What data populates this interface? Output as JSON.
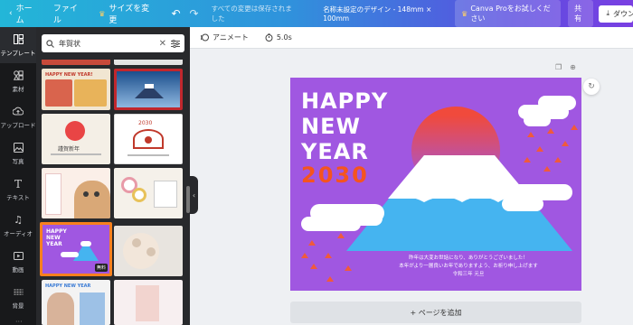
{
  "topbar": {
    "home": "ホーム",
    "file": "ファイル",
    "resize": "サイズを変更",
    "saved_status": "すべての変更は保存されました",
    "doc_name": "名称未設定のデザイン - 148mm × 100mm",
    "pro_button": "Canva Proをお試しください",
    "share": "共有",
    "download": "ダウンロード"
  },
  "rail": [
    {
      "label": "テンプレート",
      "icon": "template-icon"
    },
    {
      "label": "素材",
      "icon": "elements-icon"
    },
    {
      "label": "アップロード",
      "icon": "upload-icon"
    },
    {
      "label": "写真",
      "icon": "photo-icon"
    },
    {
      "label": "テキスト",
      "icon": "text-icon"
    },
    {
      "label": "オーディオ",
      "icon": "audio-icon"
    },
    {
      "label": "動画",
      "icon": "video-icon"
    },
    {
      "label": "背景",
      "icon": "background-icon"
    }
  ],
  "search": {
    "value": "年賀状"
  },
  "thumbs": {
    "t1_text": "HAPPY NEW YEAR!",
    "t3_text": "謹賀新年",
    "t4_year": "2030",
    "t7_line1": "HAPPY",
    "t7_line2": "NEW",
    "t7_line3": "YEAR",
    "t7_badge": "無料",
    "t9_text": "HAPPY NEW YEAR"
  },
  "toolbar": {
    "animate": "アニメート",
    "duration": "5.0s"
  },
  "card": {
    "line1": "HAPPY",
    "line2": "NEW",
    "line3": "YEAR",
    "year": "2030",
    "message1": "昨年は大変お世話になり、ありがとうございました！",
    "message2": "本年がより一層良いお年でありますよう、お祈り申し上げます",
    "message3": "令和三年 元旦"
  },
  "add_page": "+ ページを追加",
  "colors": {
    "card_bg": "#a057e1",
    "accent_orange": "#f5541f",
    "mountain_blue": "#45b4f0",
    "sun_red": "#f04a3c"
  }
}
